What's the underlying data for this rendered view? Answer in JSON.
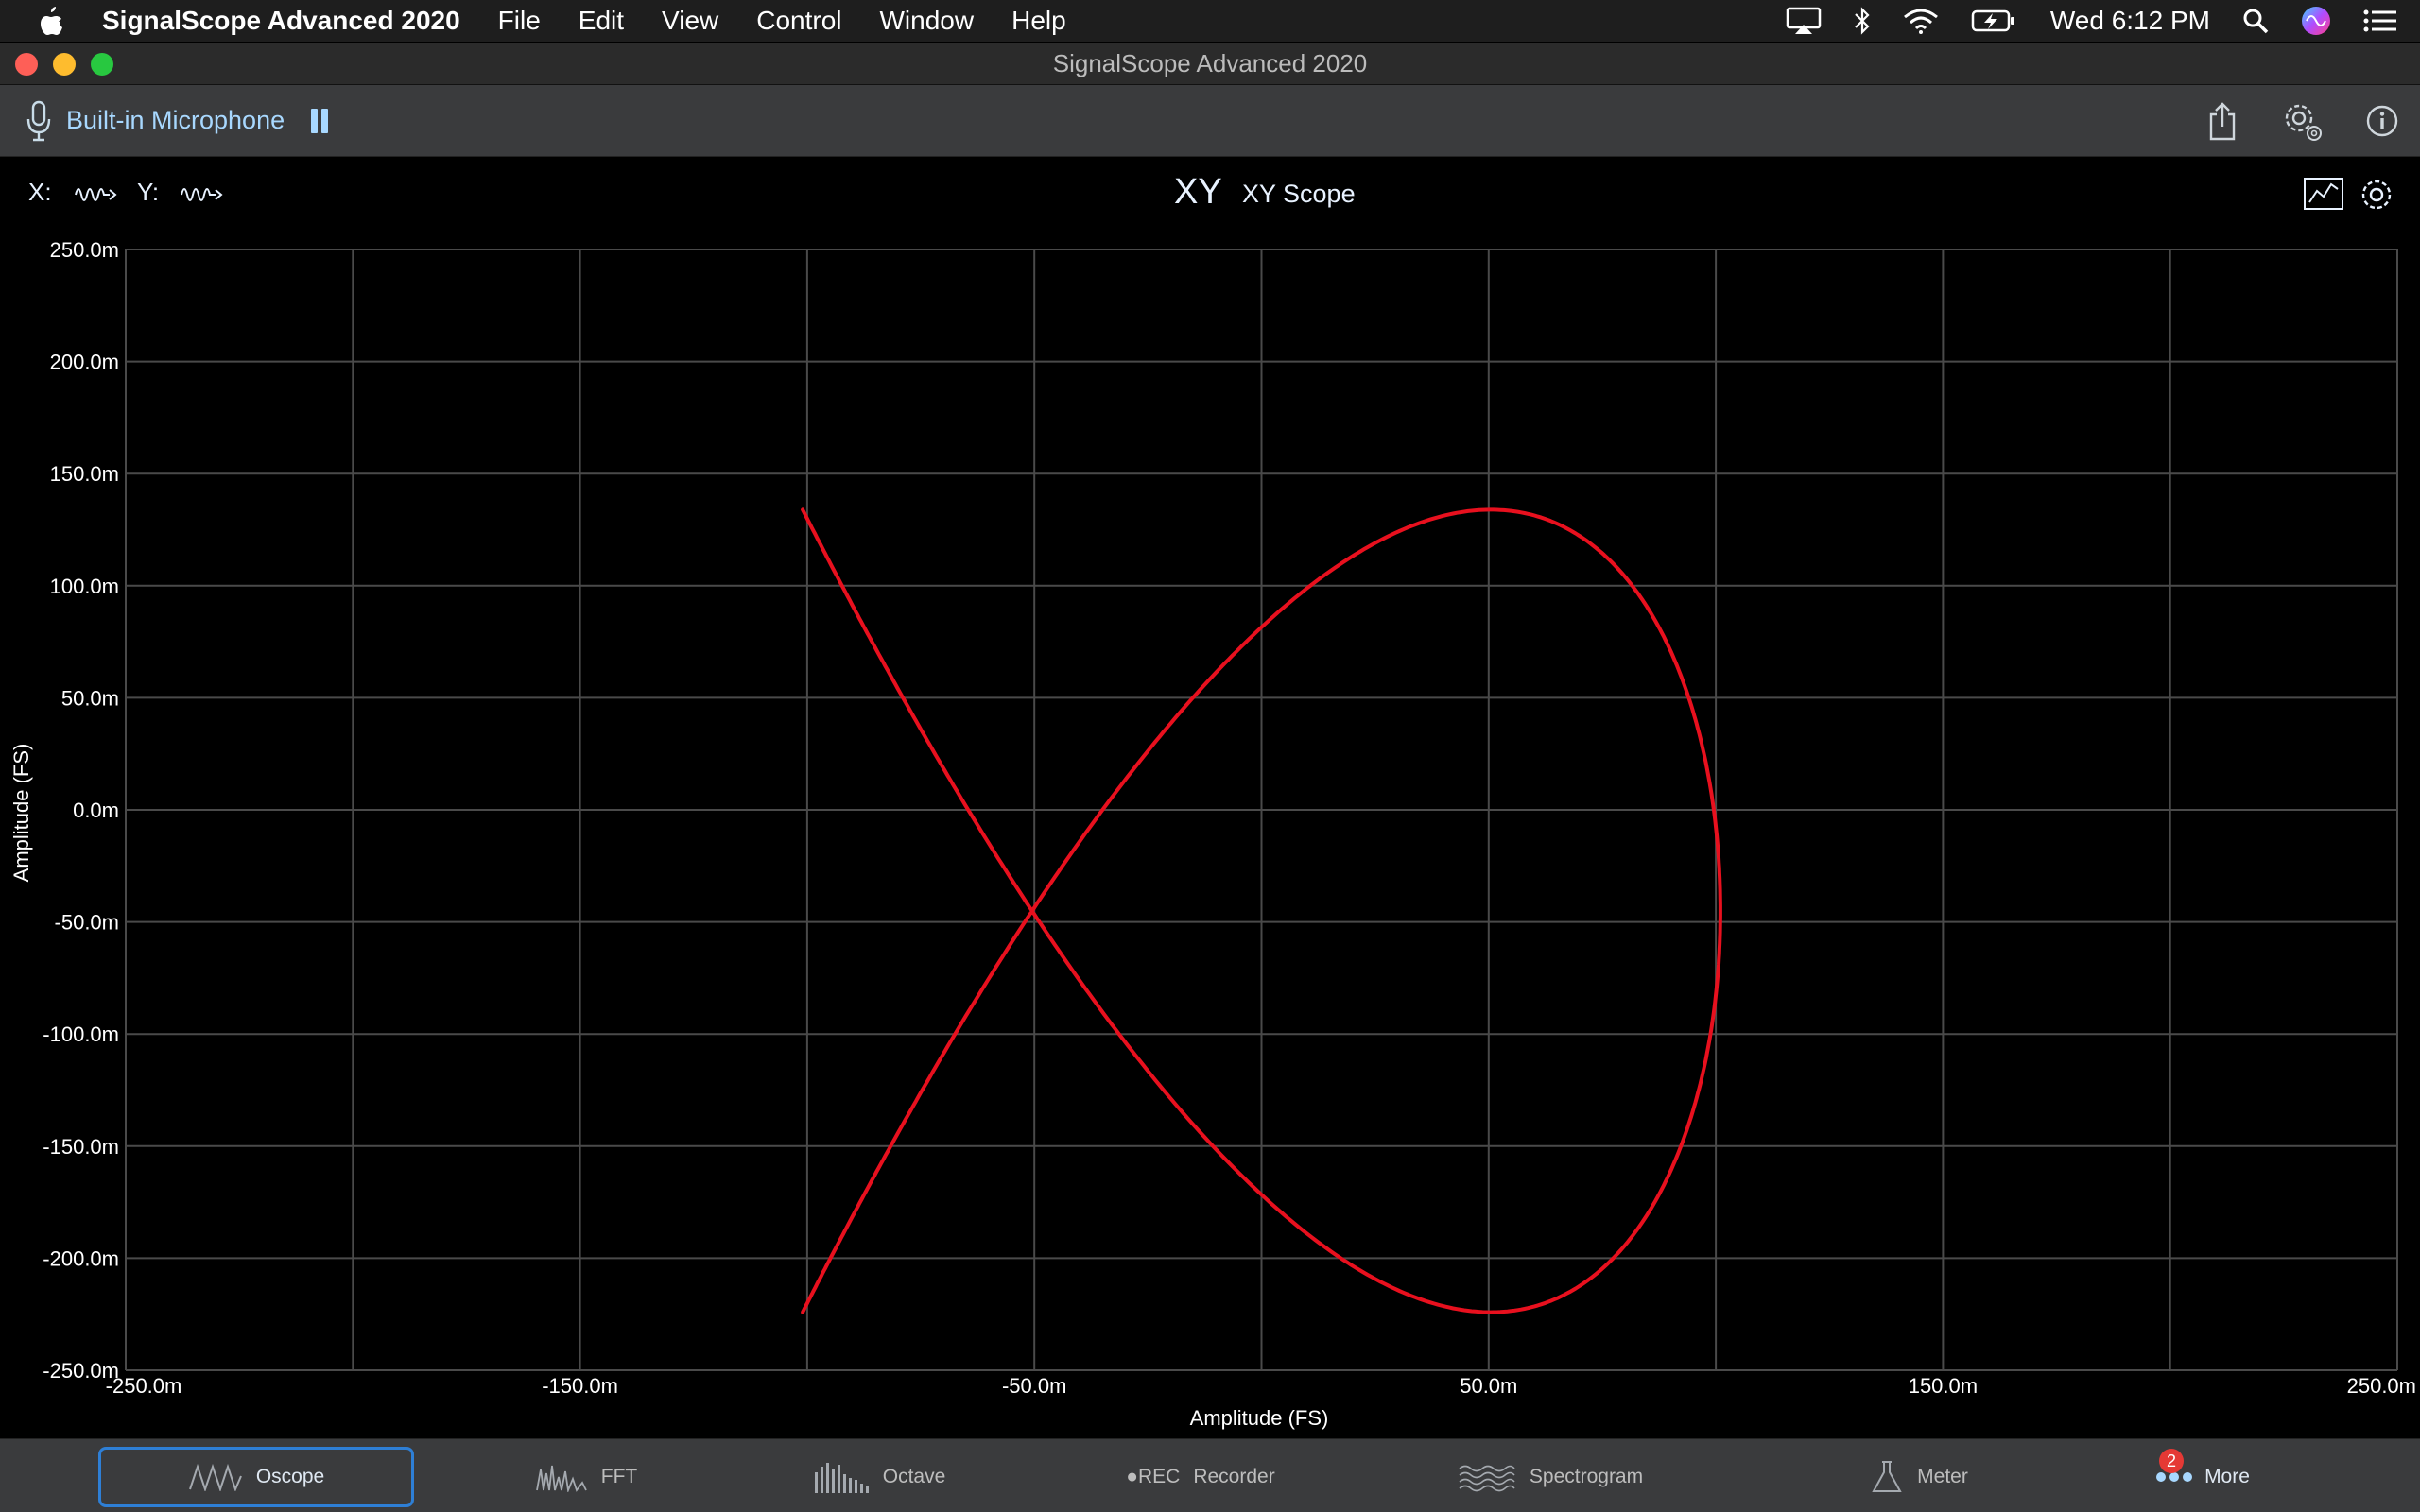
{
  "menubar": {
    "app_name": "SignalScope Advanced 2020",
    "menus": [
      "File",
      "Edit",
      "View",
      "Control",
      "Window",
      "Help"
    ],
    "clock": "Wed 6:12 PM"
  },
  "window": {
    "title": "SignalScope Advanced 2020"
  },
  "toolbar": {
    "input_source": "Built-in Microphone"
  },
  "scope": {
    "x_channel_label": "X:",
    "y_channel_label": "Y:",
    "mode_glyph": "XY",
    "title": "XY Scope"
  },
  "chart_data": {
    "type": "line",
    "xlabel": "Amplitude (FS)",
    "ylabel": "Amplitude (FS)",
    "xlim": [
      -0.25,
      0.25
    ],
    "ylim": [
      -0.25,
      0.25
    ],
    "x_tick_labels": [
      "-250.0m",
      "-150.0m",
      "-50.0m",
      "50.0m",
      "150.0m",
      "250.0m"
    ],
    "y_tick_labels": [
      "250.0m",
      "200.0m",
      "150.0m",
      "100.0m",
      "50.0m",
      "0.0m",
      "-50.0m",
      "-100.0m",
      "-150.0m",
      "-200.0m",
      "-250.0m"
    ],
    "grid": true,
    "line_color": "#e8101e",
    "series": [
      {
        "x_amplitude": 0.101,
        "y_amplitude": 0.179,
        "y_offset": 0,
        "freq_ratio": "2:3",
        "phase_deg": 90
      }
    ]
  },
  "tabs": [
    {
      "label": "Oscope",
      "icon": "oscope-wave-icon",
      "selected": true
    },
    {
      "label": "FFT",
      "icon": "fft-spectrum-icon",
      "selected": false
    },
    {
      "label": "Octave",
      "icon": "octave-bars-icon",
      "selected": false
    },
    {
      "label": "Recorder",
      "icon": "rec-icon",
      "icon_text": "●REC",
      "selected": false
    },
    {
      "label": "Spectrogram",
      "icon": "spectrogram-icon",
      "selected": false
    },
    {
      "label": "Meter",
      "icon": "meter-flask-icon",
      "selected": false
    },
    {
      "label": "More",
      "icon": "more-dots-icon",
      "badge": "2",
      "selected": false
    }
  ],
  "colors": {
    "accent": "#2e7fd6",
    "trace": "#e8101e",
    "toolbar_bg": "#3a3b3d",
    "source_text": "#a8d8ff"
  }
}
